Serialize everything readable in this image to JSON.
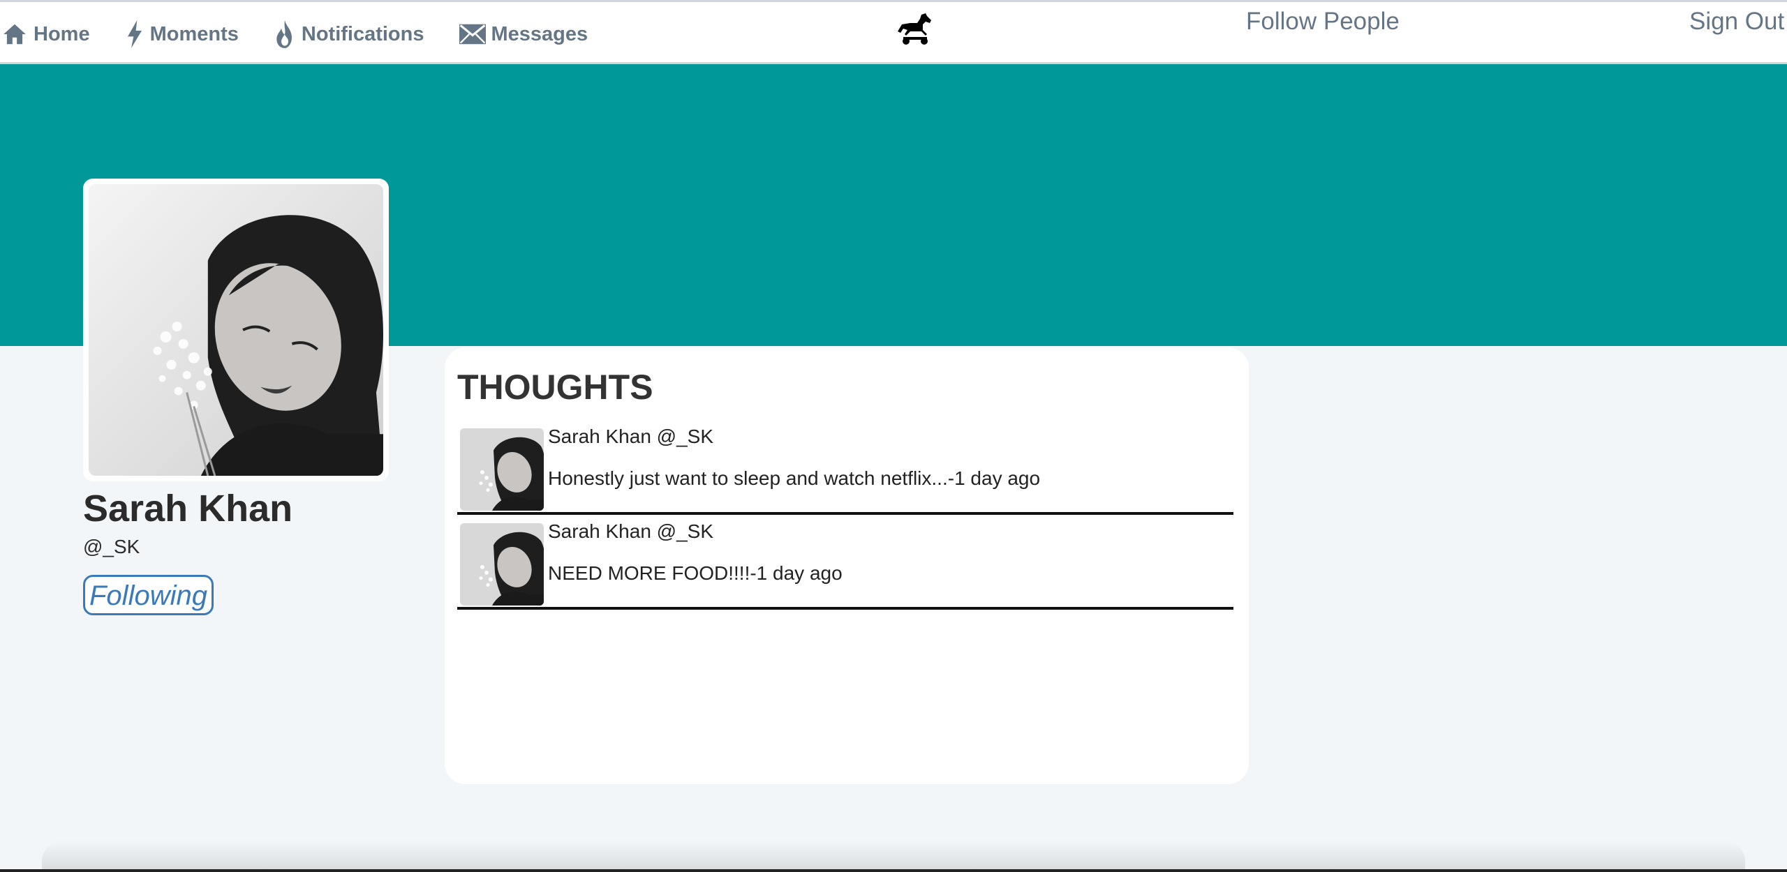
{
  "nav": {
    "items": [
      {
        "label": "Home",
        "icon": "home-icon"
      },
      {
        "label": "Moments",
        "icon": "lightning-icon"
      },
      {
        "label": "Notifications",
        "icon": "flame-icon"
      },
      {
        "label": "Messages",
        "icon": "envelope-icon"
      }
    ],
    "logo_icon": "horse-icon",
    "follow_people": "Follow People",
    "sign_out": "Sign Out"
  },
  "colors": {
    "banner": "#009898",
    "nav_text": "#647685",
    "follow_button": "#3a7ab8",
    "page_bg": "#f3f6f8"
  },
  "profile": {
    "name": "Sarah Khan",
    "handle": "@_SK",
    "follow_button": "Following"
  },
  "thoughts": {
    "title": "THOUGHTS",
    "items": [
      {
        "author": "Sarah Khan @_SK",
        "text": "Honestly just want to sleep and watch netflix...-1 day ago"
      },
      {
        "author": "Sarah Khan @_SK",
        "text": "NEED MORE FOOD!!!!-1 day ago"
      }
    ]
  }
}
